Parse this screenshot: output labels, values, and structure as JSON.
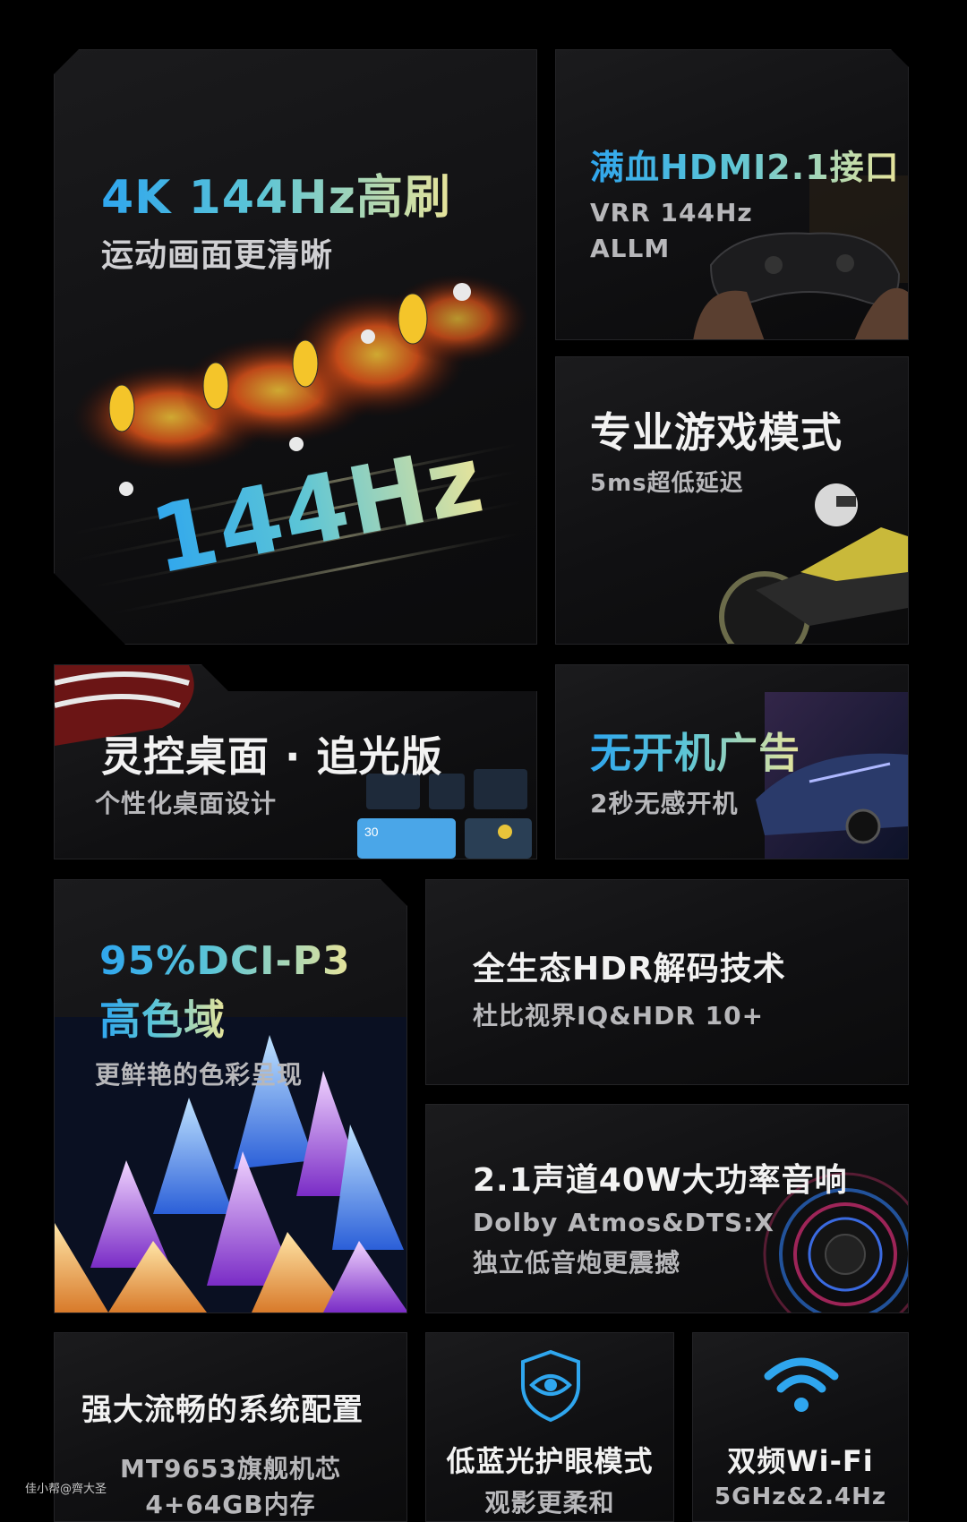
{
  "cards": {
    "refresh": {
      "title": "4K 144Hz高刷",
      "subtitle": "运动画面更清晰",
      "big_text": "144Hz"
    },
    "hdmi": {
      "title": "满血HDMI2.1接口",
      "line1": "VRR 144Hz",
      "line2": "ALLM"
    },
    "game": {
      "title": "专业游戏模式",
      "subtitle": "5ms超低延迟"
    },
    "desktop": {
      "title": "灵控桌面 · 追光版",
      "subtitle": "个性化桌面设计"
    },
    "no_ads": {
      "title": "无开机广告",
      "subtitle": "2秒无感开机"
    },
    "color": {
      "title_line1": "95%DCI-P3",
      "title_line2": "高色域",
      "subtitle": "更鲜艳的色彩呈现"
    },
    "hdr": {
      "title": "全生态HDR解码技术",
      "subtitle": "杜比视界IQ&HDR 10+"
    },
    "audio": {
      "title": "2.1声道40W大功率音响",
      "line1": "Dolby Atmos&DTS:X",
      "line2": "独立低音炮更震撼"
    },
    "system": {
      "title": "强大流畅的系统配置",
      "line1": "MT9653旗舰机芯",
      "line2": "4+64GB内存"
    },
    "eye": {
      "title": "低蓝光护眼模式",
      "subtitle": "观影更柔和",
      "icon": "shield-eye-icon"
    },
    "wifi": {
      "title": "双频Wi-Fi",
      "subtitle": "5GHz&2.4Hz",
      "icon": "wifi-icon"
    }
  },
  "widget_temp": "30",
  "watermark": "佳小帮@齊大圣",
  "colors": {
    "accent_blue": "#2fa6ee",
    "accent_yellow": "#e8e49a",
    "background": "#000000"
  }
}
